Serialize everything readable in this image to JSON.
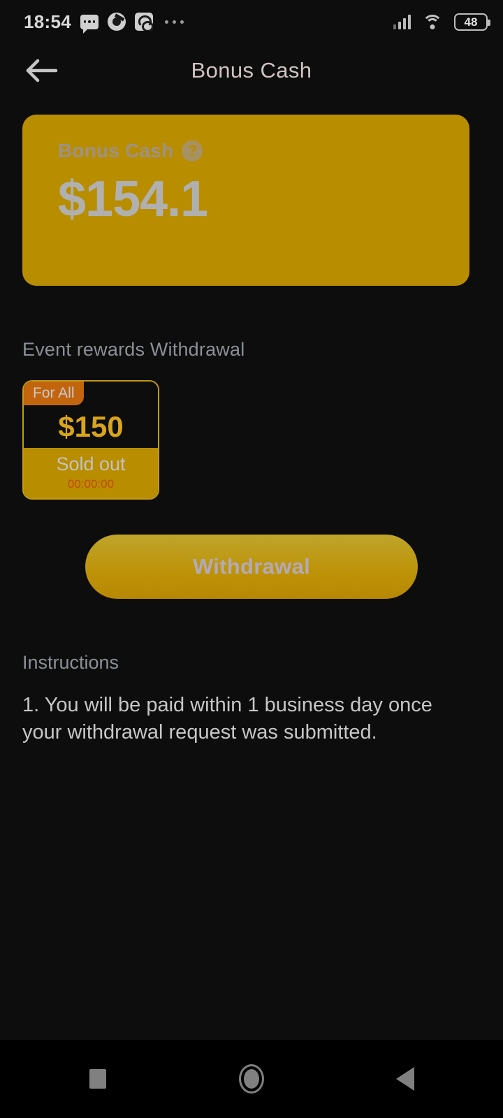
{
  "status_bar": {
    "time": "18:54",
    "battery_level": "48",
    "icons": [
      "messages-icon",
      "chrome-icon",
      "app-icon",
      "overflow-dots-icon",
      "signal-icon",
      "wifi-icon",
      "battery-icon"
    ]
  },
  "app_bar": {
    "back_label": "Back",
    "title": "Bonus Cash"
  },
  "balance_card": {
    "label": "Bonus Cash",
    "help_glyph": "?",
    "amount": "$154.1",
    "bg_color": "#b98d00"
  },
  "rewards_section": {
    "title": "Event rewards Withdrawal",
    "items": [
      {
        "badge": "For All",
        "price": "$150",
        "status": "Sold out",
        "timer": "00:00:00",
        "badge_color": "#c2650e",
        "border_color": "#c49a12",
        "price_color": "#d9a41a",
        "timer_color": "#c2490e"
      }
    ]
  },
  "cta": {
    "label": "Withdrawal"
  },
  "instructions": {
    "title": "Instructions",
    "text": "1. You will be paid within 1 business day once your withdrawal request was submitted."
  },
  "nav_bar": {
    "recents_label": "Recents",
    "home_label": "Home",
    "back_label": "Back"
  }
}
